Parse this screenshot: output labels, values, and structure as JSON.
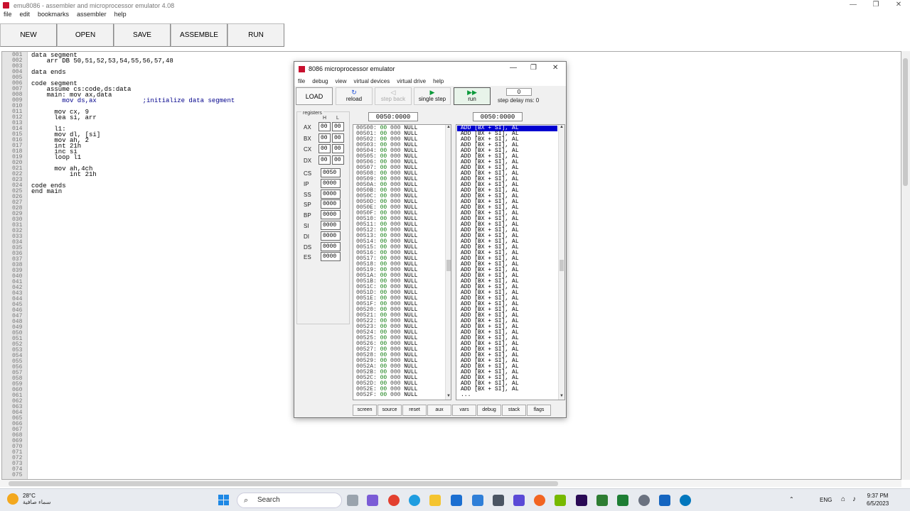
{
  "window": {
    "title": "emu8086 - assembler and microprocessor emulator 4.08",
    "controls": [
      "—",
      "❐",
      "✕"
    ]
  },
  "menu": [
    "file",
    "edit",
    "bookmarks",
    "assembler",
    "help"
  ],
  "toolbar": [
    "NEW",
    "OPEN",
    "SAVE",
    "ASSEMBLE",
    "RUN"
  ],
  "editor": {
    "line_numbers": [
      "001",
      "002",
      "003",
      "004",
      "005",
      "006",
      "007",
      "008",
      "009",
      "010",
      "011",
      "012",
      "013",
      "014",
      "015",
      "016",
      "017",
      "018",
      "019",
      "020",
      "021",
      "022",
      "023",
      "024",
      "025",
      "026",
      "027",
      "028",
      "029",
      "030",
      "031",
      "032",
      "033",
      "034",
      "035",
      "036",
      "037",
      "038",
      "039",
      "040",
      "041",
      "042",
      "043",
      "044",
      "045",
      "046",
      "047",
      "048",
      "049",
      "050",
      "051",
      "052",
      "053",
      "054",
      "055",
      "056",
      "057",
      "058",
      "059",
      "060",
      "061",
      "062",
      "063",
      "064",
      "065",
      "066",
      "067",
      "068",
      "069",
      "070",
      "071",
      "072",
      "073",
      "074",
      "075"
    ],
    "code_lines": [
      "data segment",
      "    arr DB 50,51,52,53,54,55,56,57,48",
      "",
      "data ends",
      "",
      "code segment",
      "    assume cs:code,ds:data",
      "    main: mov ax,data",
      "        mov ds,ax            ;initialize data segment",
      "",
      "      mov cx, 9",
      "      lea si, arr",
      "",
      "      l1:",
      "      mov dl, [si]",
      "      mov ah, 2",
      "      int 21h",
      "      inc si",
      "      loop l1",
      "",
      "      mov ah,4ch",
      "          int 21h",
      "",
      "code ends",
      "end main"
    ]
  },
  "emulator": {
    "title": "8086 microprocessor emulator",
    "menu": [
      "file",
      "debug",
      "view",
      "virtual devices",
      "virtual drive",
      "help"
    ],
    "load_label": "LOAD",
    "tools": [
      {
        "label": "reload",
        "glyph": "↻",
        "disabled": false
      },
      {
        "label": "step back",
        "glyph": "◁",
        "disabled": true
      },
      {
        "label": "single step",
        "glyph": "▶",
        "disabled": false
      },
      {
        "label": "run",
        "glyph": "▶▶",
        "disabled": false
      }
    ],
    "step_delay_value": "0",
    "step_delay_label": "step delay ms: 0",
    "registers_title": "registers",
    "h_label": "H",
    "l_label": "L",
    "registers_hl": [
      {
        "name": "AX",
        "h": "00",
        "l": "00"
      },
      {
        "name": "BX",
        "h": "00",
        "l": "00"
      },
      {
        "name": "CX",
        "h": "00",
        "l": "00"
      },
      {
        "name": "DX",
        "h": "00",
        "l": "00"
      }
    ],
    "registers_16": [
      {
        "name": "CS",
        "v": "0050"
      },
      {
        "name": "IP",
        "v": "0000"
      },
      {
        "name": "SS",
        "v": "0000"
      },
      {
        "name": "SP",
        "v": "0000"
      },
      {
        "name": "BP",
        "v": "0000"
      },
      {
        "name": "SI",
        "v": "0000"
      },
      {
        "name": "DI",
        "v": "0000"
      },
      {
        "name": "DS",
        "v": "0000"
      },
      {
        "name": "ES",
        "v": "0000"
      }
    ],
    "address_left": "0050:0000",
    "address_right": "0050:0000",
    "memory": {
      "addresses": [
        "00500",
        "00501",
        "00502",
        "00503",
        "00504",
        "00505",
        "00506",
        "00507",
        "00508",
        "00509",
        "0050A",
        "0050B",
        "0050C",
        "0050D",
        "0050E",
        "0050F",
        "00510",
        "00511",
        "00512",
        "00513",
        "00514",
        "00515",
        "00516",
        "00517",
        "00518",
        "00519",
        "0051A",
        "0051B",
        "0051C",
        "0051D",
        "0051E",
        "0051F",
        "00520",
        "00521",
        "00522",
        "00523",
        "00524",
        "00525",
        "00526",
        "00527",
        "00528",
        "00529",
        "0052A",
        "0052B",
        "0052C",
        "0052D",
        "0052E",
        "0052F"
      ],
      "hex": "00",
      "dec": "000",
      "char": "NULL"
    },
    "disassembly": {
      "instruction": "ADD [BX + SI], AL",
      "count": 47,
      "tail": "..."
    },
    "bottom_buttons": [
      "screen",
      "source",
      "reset",
      "aux",
      "vars",
      "debug",
      "stack",
      "flags"
    ]
  },
  "taskbar": {
    "temperature": "28°C",
    "weather_text": "سماء صافية",
    "search_label": "Search",
    "search_icon": "magnifier-icon",
    "language": "ENG",
    "time": "9:37 PM",
    "date": "6/5/2023"
  }
}
